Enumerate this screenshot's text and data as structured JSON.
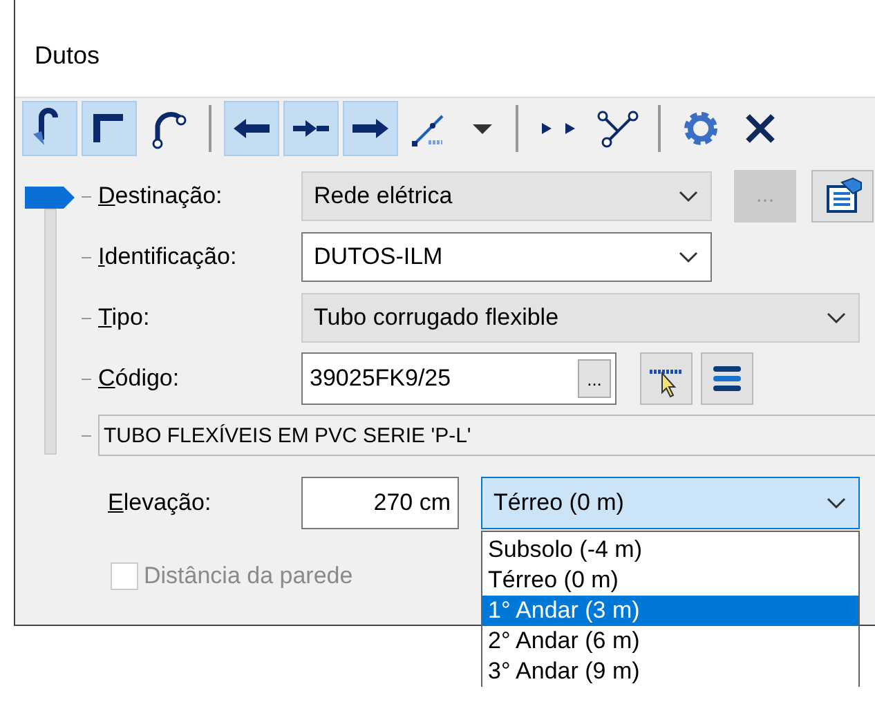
{
  "window": {
    "title": "Dutos"
  },
  "toolbar": [
    {
      "kind": "hook",
      "pressed": true
    },
    {
      "kind": "corner",
      "pressed": true
    },
    {
      "kind": "arc",
      "pressed": false
    },
    {
      "kind": "separator"
    },
    {
      "kind": "arrow-left",
      "pressed": true
    },
    {
      "kind": "arrow-middle",
      "pressed": true
    },
    {
      "kind": "arrow-right",
      "pressed": true
    },
    {
      "kind": "slope",
      "pressed": false
    },
    {
      "kind": "caret",
      "pressed": false
    },
    {
      "kind": "separator"
    },
    {
      "kind": "points",
      "pressed": false
    },
    {
      "kind": "split",
      "pressed": false
    },
    {
      "kind": "separator"
    },
    {
      "kind": "gear",
      "pressed": false
    },
    {
      "kind": "close",
      "pressed": false
    }
  ],
  "rows": [
    {
      "kind": "combo",
      "label": "Destinação:",
      "value": "Rede elétrica",
      "editable": false,
      "wide": false,
      "buttons": [
        {
          "kind": "ellipsis",
          "label": "...",
          "disabled": true
        },
        {
          "kind": "properties",
          "disabled": false
        }
      ]
    },
    {
      "kind": "combo",
      "label": "Identificação:",
      "value": "DUTOS-ILM",
      "editable": true,
      "wide": false
    },
    {
      "kind": "combo",
      "label": "Tipo:",
      "value": "Tubo corrugado flexible",
      "editable": false,
      "wide": true
    },
    {
      "kind": "code",
      "label": "Código:",
      "value": "39025FK9/25",
      "inner_button": "...",
      "buttons": [
        {
          "kind": "pick",
          "disabled": false
        },
        {
          "kind": "list",
          "disabled": false
        }
      ]
    },
    {
      "kind": "description",
      "value": "TUBO FLEXÍVEIS EM PVC SERIE 'P-L'"
    }
  ],
  "elevation": {
    "label": "Elevação:",
    "value": "270 cm",
    "floor": {
      "value": "Térreo (0 m)",
      "open": true,
      "options": [
        {
          "label": "Subsolo (-4 m)",
          "highlighted": false
        },
        {
          "label": "Térreo (0 m)",
          "highlighted": false
        },
        {
          "label": "1° Andar (3 m)",
          "highlighted": true
        },
        {
          "label": "2° Andar (6 m)",
          "highlighted": false
        },
        {
          "label": "3° Andar (9 m)",
          "highlighted": false
        }
      ]
    }
  },
  "checkbox": {
    "label": "Distância da parede",
    "checked": false,
    "disabled": true
  }
}
